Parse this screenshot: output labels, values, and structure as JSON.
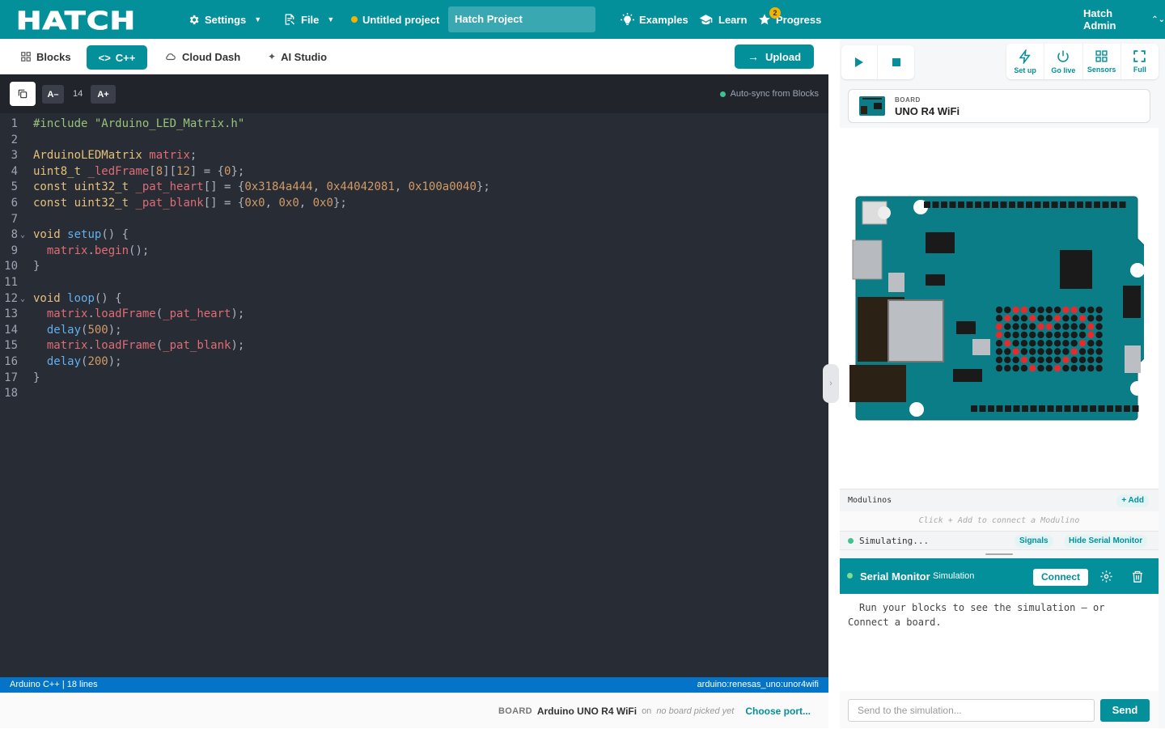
{
  "topbar": {
    "logo": "HATCH",
    "settings_label": "Settings",
    "file_label": "File",
    "untitled_label": "Untitled project",
    "project_name": "Hatch Project",
    "examples_label": "Examples",
    "learn_label": "Learn",
    "progress_label": "Progress",
    "progress_badge": "2",
    "user_label": "Hatch Admin"
  },
  "subbar": {
    "blocks_label": "Blocks",
    "cpp_label": "C++",
    "cloud_label": "Cloud Dash",
    "ai_label": "AI Studio",
    "upload_label": "Upload"
  },
  "editor": {
    "font_minus": "A–",
    "font_size": "14",
    "font_plus": "A+",
    "autosync": "Auto-sync from Blocks",
    "lines": [
      {
        "n": "1",
        "fold": ""
      },
      {
        "n": "2",
        "fold": ""
      },
      {
        "n": "3",
        "fold": ""
      },
      {
        "n": "4",
        "fold": ""
      },
      {
        "n": "5",
        "fold": ""
      },
      {
        "n": "6",
        "fold": ""
      },
      {
        "n": "7",
        "fold": ""
      },
      {
        "n": "8",
        "fold": "⌄"
      },
      {
        "n": "9",
        "fold": ""
      },
      {
        "n": "10",
        "fold": ""
      },
      {
        "n": "11",
        "fold": ""
      },
      {
        "n": "12",
        "fold": "⌄"
      },
      {
        "n": "13",
        "fold": ""
      },
      {
        "n": "14",
        "fold": ""
      },
      {
        "n": "15",
        "fold": ""
      },
      {
        "n": "16",
        "fold": ""
      },
      {
        "n": "17",
        "fold": ""
      },
      {
        "n": "18",
        "fold": ""
      }
    ],
    "code": [
      [
        {
          "c": "k-inc",
          "t": "#include \"Arduino_LED_Matrix.h\""
        }
      ],
      [],
      [
        {
          "c": "k-type",
          "t": "ArduinoLEDMatrix "
        },
        {
          "c": "k-var",
          "t": "matrix"
        },
        {
          "c": "",
          "t": ";"
        }
      ],
      [
        {
          "c": "k-type",
          "t": "uint8_t "
        },
        {
          "c": "k-var",
          "t": "_ledFrame"
        },
        {
          "c": "",
          "t": "["
        },
        {
          "c": "k-num",
          "t": "8"
        },
        {
          "c": "",
          "t": "]["
        },
        {
          "c": "k-num",
          "t": "12"
        },
        {
          "c": "",
          "t": "] = {"
        },
        {
          "c": "k-num",
          "t": "0"
        },
        {
          "c": "",
          "t": "};"
        }
      ],
      [
        {
          "c": "k-type",
          "t": "const uint32_t "
        },
        {
          "c": "k-var",
          "t": "_pat_heart"
        },
        {
          "c": "",
          "t": "[] = {"
        },
        {
          "c": "k-num",
          "t": "0x3184a444"
        },
        {
          "c": "",
          "t": ", "
        },
        {
          "c": "k-num",
          "t": "0x44042081"
        },
        {
          "c": "",
          "t": ", "
        },
        {
          "c": "k-num",
          "t": "0x100a0040"
        },
        {
          "c": "",
          "t": "};"
        }
      ],
      [
        {
          "c": "k-type",
          "t": "const uint32_t "
        },
        {
          "c": "k-var",
          "t": "_pat_blank"
        },
        {
          "c": "",
          "t": "[] = {"
        },
        {
          "c": "k-num",
          "t": "0x0"
        },
        {
          "c": "",
          "t": ", "
        },
        {
          "c": "k-num",
          "t": "0x0"
        },
        {
          "c": "",
          "t": ", "
        },
        {
          "c": "k-num",
          "t": "0x0"
        },
        {
          "c": "",
          "t": "};"
        }
      ],
      [],
      [
        {
          "c": "k-type",
          "t": "void "
        },
        {
          "c": "k-fn",
          "t": "setup"
        },
        {
          "c": "",
          "t": "() {"
        }
      ],
      [
        {
          "c": "",
          "t": "  "
        },
        {
          "c": "k-var",
          "t": "matrix"
        },
        {
          "c": "",
          "t": "."
        },
        {
          "c": "k-var",
          "t": "begin"
        },
        {
          "c": "",
          "t": "();"
        }
      ],
      [
        {
          "c": "",
          "t": "}"
        }
      ],
      [],
      [
        {
          "c": "k-type",
          "t": "void "
        },
        {
          "c": "k-fn",
          "t": "loop"
        },
        {
          "c": "",
          "t": "() {"
        }
      ],
      [
        {
          "c": "",
          "t": "  "
        },
        {
          "c": "k-var",
          "t": "matrix"
        },
        {
          "c": "",
          "t": "."
        },
        {
          "c": "k-var",
          "t": "loadFrame"
        },
        {
          "c": "",
          "t": "("
        },
        {
          "c": "k-var",
          "t": "_pat_heart"
        },
        {
          "c": "",
          "t": ");"
        }
      ],
      [
        {
          "c": "",
          "t": "  "
        },
        {
          "c": "k-fn",
          "t": "delay"
        },
        {
          "c": "",
          "t": "("
        },
        {
          "c": "k-num",
          "t": "500"
        },
        {
          "c": "",
          "t": ");"
        }
      ],
      [
        {
          "c": "",
          "t": "  "
        },
        {
          "c": "k-var",
          "t": "matrix"
        },
        {
          "c": "",
          "t": "."
        },
        {
          "c": "k-var",
          "t": "loadFrame"
        },
        {
          "c": "",
          "t": "("
        },
        {
          "c": "k-var",
          "t": "_pat_blank"
        },
        {
          "c": "",
          "t": ");"
        }
      ],
      [
        {
          "c": "",
          "t": "  "
        },
        {
          "c": "k-fn",
          "t": "delay"
        },
        {
          "c": "",
          "t": "("
        },
        {
          "c": "k-num",
          "t": "200"
        },
        {
          "c": "",
          "t": ");"
        }
      ],
      [
        {
          "c": "",
          "t": "}"
        }
      ],
      []
    ]
  },
  "statusbar": {
    "left": "Arduino C++ | 18 lines",
    "right": "arduino:renesas_uno:unor4wifi"
  },
  "footer": {
    "board_caption": "BOARD",
    "board_name": "Arduino UNO R4 WiFi",
    "on_label": "on",
    "port_status": "no board picked yet",
    "choose_port": "Choose port..."
  },
  "simpanel": {
    "tools": [
      {
        "label": "Set up",
        "icon": "bolt-icon"
      },
      {
        "label": "Go live",
        "icon": "power-icon"
      },
      {
        "label": "Sensors",
        "icon": "grid-icon"
      },
      {
        "label": "Full",
        "icon": "fullscreen-icon"
      }
    ],
    "board_caption": "BOARD",
    "board_name": "UNO R4 WiFi",
    "modulinos_label": "Modulinos",
    "add_label": "+ Add",
    "modulino_hint": "Click + Add to connect a Modulino",
    "sim_status": "Simulating...",
    "signals_label": "Signals",
    "hide_serial_label": "Hide Serial Monitor"
  },
  "serial": {
    "title": "Serial Monitor",
    "mode": "Simulation",
    "connect_label": "Connect",
    "message": "Run your blocks to see the simulation — or Connect a board.",
    "input_placeholder": "Send to the simulation...",
    "send_label": "Send"
  },
  "colors": {
    "brand": "#03909b",
    "editor_bg": "#282c34",
    "status_blue": "#0374c8",
    "board_teal": "#0b7d87"
  }
}
